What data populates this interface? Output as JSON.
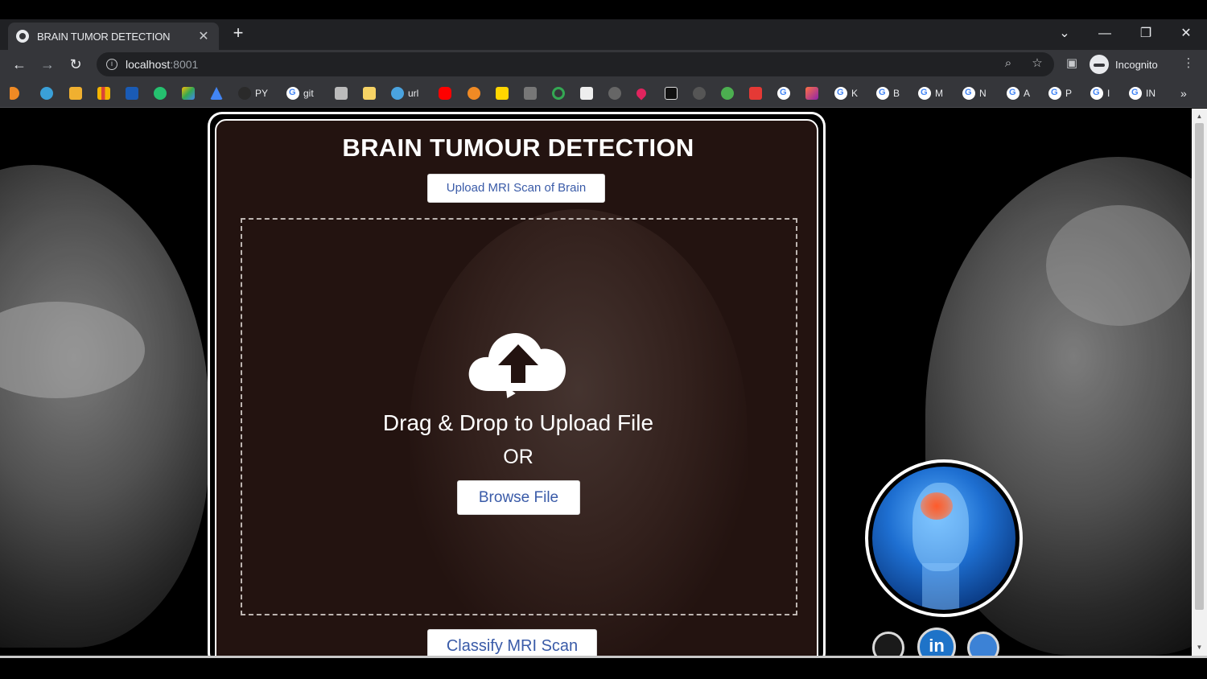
{
  "browser": {
    "tab_title": "BRAIN TUMOR DETECTION",
    "tab_close": "✕",
    "new_tab": "+",
    "url_host": "localhost",
    "url_port": ":8001",
    "profile_label": "Incognito",
    "bookmarks": [
      "PY",
      "git",
      "url",
      "K",
      "B",
      "M",
      "N",
      "A",
      "P",
      "I",
      "IN"
    ]
  },
  "page": {
    "title": "BRAIN TUMOUR DETECTION",
    "upload_button": "Upload MRI Scan of Brain",
    "drag_text": "Drag & Drop to Upload File",
    "or_text": "OR",
    "browse_button": "Browse File",
    "classify_button": "Classify MRI Scan",
    "linkedin_label": "in"
  },
  "colors": {
    "panel_bg": "#231310",
    "button_text": "#3a5ba8",
    "chrome_dark": "#202124",
    "chrome_toolbar": "#35363a"
  }
}
